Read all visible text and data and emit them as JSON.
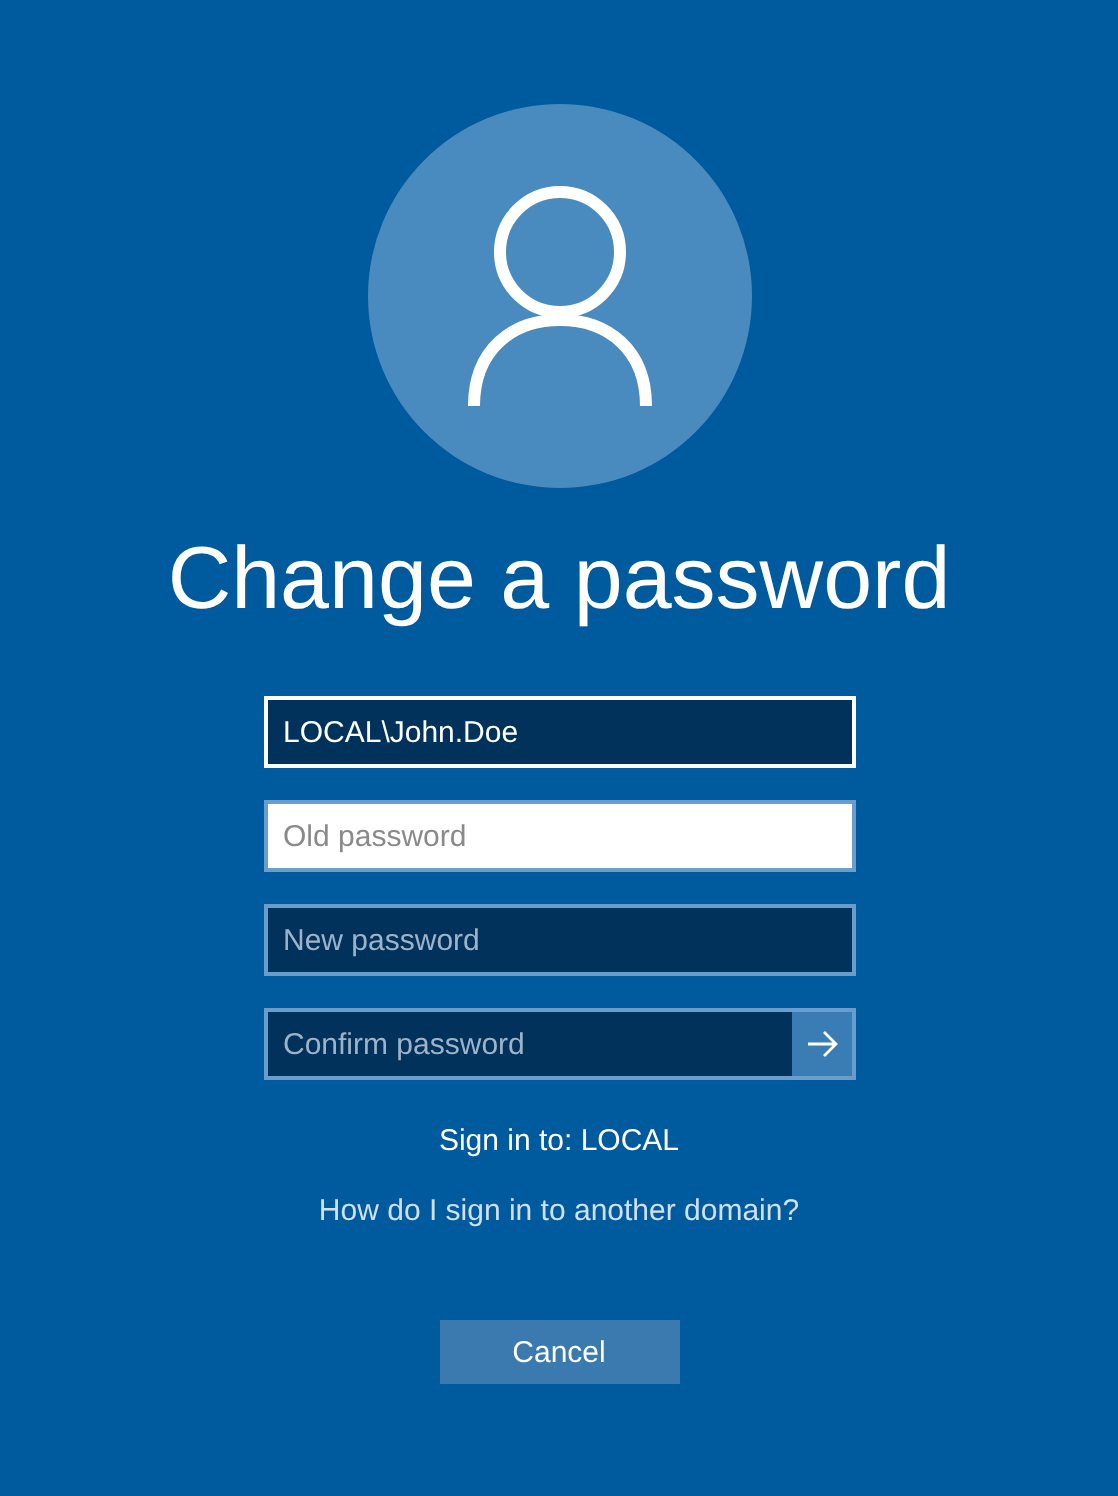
{
  "title": "Change a password",
  "fields": [
    {
      "value": "LOCAL\\John.Doe",
      "focused": false,
      "submit": false
    },
    {
      "placeholder": "Old password",
      "focused": true,
      "submit": false
    },
    {
      "placeholder": "New password",
      "focused": false,
      "submit": false
    },
    {
      "placeholder": "Confirm password",
      "focused": false,
      "submit": true
    }
  ],
  "sign_in_to": "Sign in to: LOCAL",
  "help_link": "How do I sign in to another domain?",
  "cancel_button": "Cancel"
}
